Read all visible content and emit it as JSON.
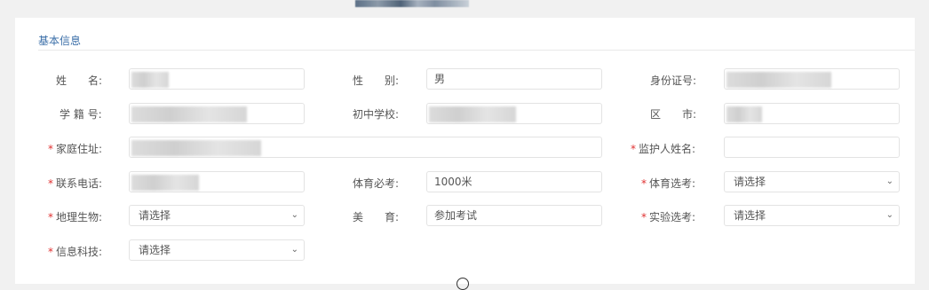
{
  "section": {
    "title": "基本信息"
  },
  "rows": {
    "r1": {
      "name_label": "姓　　名:",
      "gender_label": "性　　别:",
      "gender_value": "男",
      "idcard_label": "身份证号:"
    },
    "r2": {
      "studentno_label": "学 籍 号:",
      "school_label": "初中学校:",
      "district_label": "区　　市:"
    },
    "r3": {
      "address_label": "家庭住址:",
      "guardian_label": "监护人姓名:"
    },
    "r4": {
      "phone_label": "联系电话:",
      "pe_required_label": "体育必考:",
      "pe_required_value": "1000米",
      "pe_elective_label": "体育选考:",
      "pe_elective_value": "请选择"
    },
    "r5": {
      "geo_bio_label": "地理生物:",
      "geo_bio_value": "请选择",
      "art_label": "美　　育:",
      "art_value": "参加考试",
      "lab_label": "实验选考:",
      "lab_value": "请选择"
    },
    "r6": {
      "it_label": "信息科技:",
      "it_value": "请选择"
    }
  },
  "required_mark": "*",
  "icons": {
    "chevron": "chevron-down-icon",
    "spinner": "loading-spinner-icon"
  }
}
